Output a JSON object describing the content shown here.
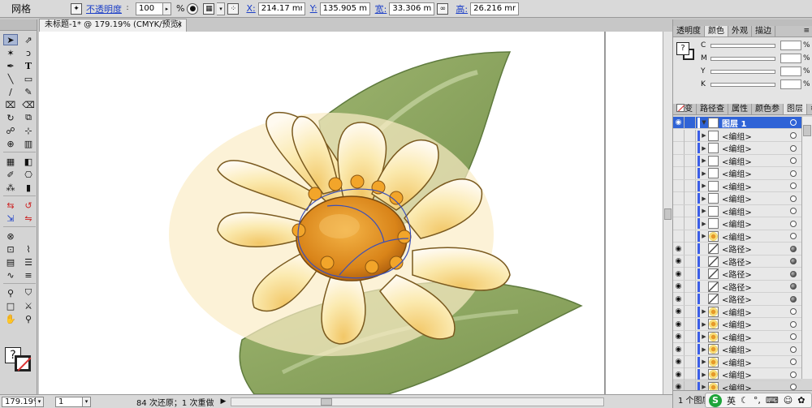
{
  "control_bar": {
    "selection_label": "网格",
    "opacity_label": "不透明度",
    "opacity_value": "100",
    "opacity_unit": "%",
    "x_label": "X:",
    "x_value": "214.17 mm",
    "y_label": "Y:",
    "y_value": "135.905 mm",
    "w_label": "宽:",
    "w_value": "33.306 mm",
    "h_label": "高:",
    "h_value": "26.216 mm"
  },
  "document": {
    "tab_title": "未标题-1* @ 179.19% (CMYK/预览)",
    "close_glyph": "×"
  },
  "status_bar": {
    "zoom": "179.19%",
    "artboard": "1",
    "message": "84 次还原；1 次重做",
    "arrow": "▶"
  },
  "color_panel": {
    "tabs": [
      "透明度",
      "颜色",
      "外观",
      "描边"
    ],
    "active_tab": "颜色",
    "channels": [
      "C",
      "M",
      "Y",
      "K"
    ],
    "pct": "%",
    "menu": "≡"
  },
  "layers_panel": {
    "tabs": [
      "渐变",
      "路径查",
      "属性",
      "颜色参",
      "图层"
    ],
    "active_tab": "图层",
    "menu": "≡",
    "top_layer": "图层 1",
    "rows": [
      {
        "name": "<编组>",
        "type": "group",
        "visible": false
      },
      {
        "name": "<编组>",
        "type": "group",
        "visible": false
      },
      {
        "name": "<编组>",
        "type": "group",
        "visible": false
      },
      {
        "name": "<编组>",
        "type": "group",
        "visible": false
      },
      {
        "name": "<编组>",
        "type": "group",
        "visible": false
      },
      {
        "name": "<编组>",
        "type": "group",
        "visible": false
      },
      {
        "name": "<编组>",
        "type": "group",
        "visible": false
      },
      {
        "name": "<编组>",
        "type": "group",
        "visible": false
      },
      {
        "name": "<编组>",
        "type": "flower",
        "visible": false
      },
      {
        "name": "<路径>",
        "type": "path",
        "visible": true
      },
      {
        "name": "<路径>",
        "type": "path",
        "visible": true
      },
      {
        "name": "<路径>",
        "type": "path",
        "visible": true
      },
      {
        "name": "<路径>",
        "type": "path",
        "visible": true
      },
      {
        "name": "<路径>",
        "type": "path",
        "visible": true
      },
      {
        "name": "<编组>",
        "type": "flower",
        "visible": true
      },
      {
        "name": "<编组>",
        "type": "flower",
        "visible": true
      },
      {
        "name": "<编组>",
        "type": "flower",
        "visible": true
      },
      {
        "name": "<编组>",
        "type": "flower",
        "visible": true
      },
      {
        "name": "<编组>",
        "type": "flower",
        "visible": true
      },
      {
        "name": "<编组>",
        "type": "flower",
        "visible": true
      },
      {
        "name": "<编组>",
        "type": "flower",
        "visible": true
      }
    ],
    "footer": "1 个图层"
  },
  "ime": {
    "logo": "S",
    "lang": "英"
  },
  "colors": {
    "leaf": "#8fa862",
    "leaf_dark": "#5e7a3d",
    "petal": "#fbeeb8",
    "petal_shade": "#f3d27a",
    "center": "#e3901f",
    "center_dark": "#b9660f",
    "selection": "#3b4fb8"
  }
}
